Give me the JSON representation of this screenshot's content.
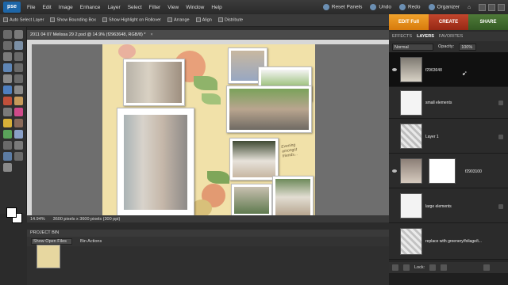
{
  "app": {
    "logo": "pse"
  },
  "menubar": {
    "items": [
      "File",
      "Edit",
      "Image",
      "Enhance",
      "Layer",
      "Select",
      "Filter",
      "View",
      "Window",
      "Help"
    ]
  },
  "topright": {
    "reset_panels": "Reset Panels",
    "undo": "Undo",
    "redo": "Redo",
    "organizer": "Organizer"
  },
  "options": {
    "auto_select": "Auto Select Layer",
    "bounding_box": "Show Bounding Box",
    "highlight": "Show Highlight on Rollover",
    "arrange": "Arrange",
    "align": "Align",
    "distribute": "Distribute"
  },
  "modes": {
    "edit": "EDIT Full",
    "create": "CREATE",
    "share": "SHARE"
  },
  "document": {
    "tab_title": "2011 04 07 Melissa 29 2.psd @ 14.9% (f2963648, RGB/8) *",
    "close": "×"
  },
  "page_text": {
    "journal": "Evening amongst friends..."
  },
  "status": {
    "zoom": "14.94%",
    "size": "3600 pixels x 3600 pixels (300 ppi)"
  },
  "project_bin": {
    "title": "PROJECT BIN",
    "show": "Show Open Files",
    "actions": "Bin Actions"
  },
  "panel": {
    "tabs": [
      "EFFECTS",
      "LAYERS",
      "FAVORITES"
    ],
    "active_tab": "LAYERS",
    "blend_mode": "Normal",
    "opacity_label": "Opacity:",
    "opacity_value": "100%",
    "lock_label": "Lock:"
  },
  "layers": [
    {
      "name": "f2963648"
    },
    {
      "name": "small elements"
    },
    {
      "name": "Layer 1"
    },
    {
      "name": "f2903100"
    },
    {
      "name": "large elements"
    },
    {
      "name": "replace with greenery/foliage/t..."
    }
  ],
  "colors": {
    "accent_edit": "#e8901c",
    "accent_create": "#b23a22",
    "accent_share": "#44702f",
    "page_bg": "#f1e1a9"
  }
}
